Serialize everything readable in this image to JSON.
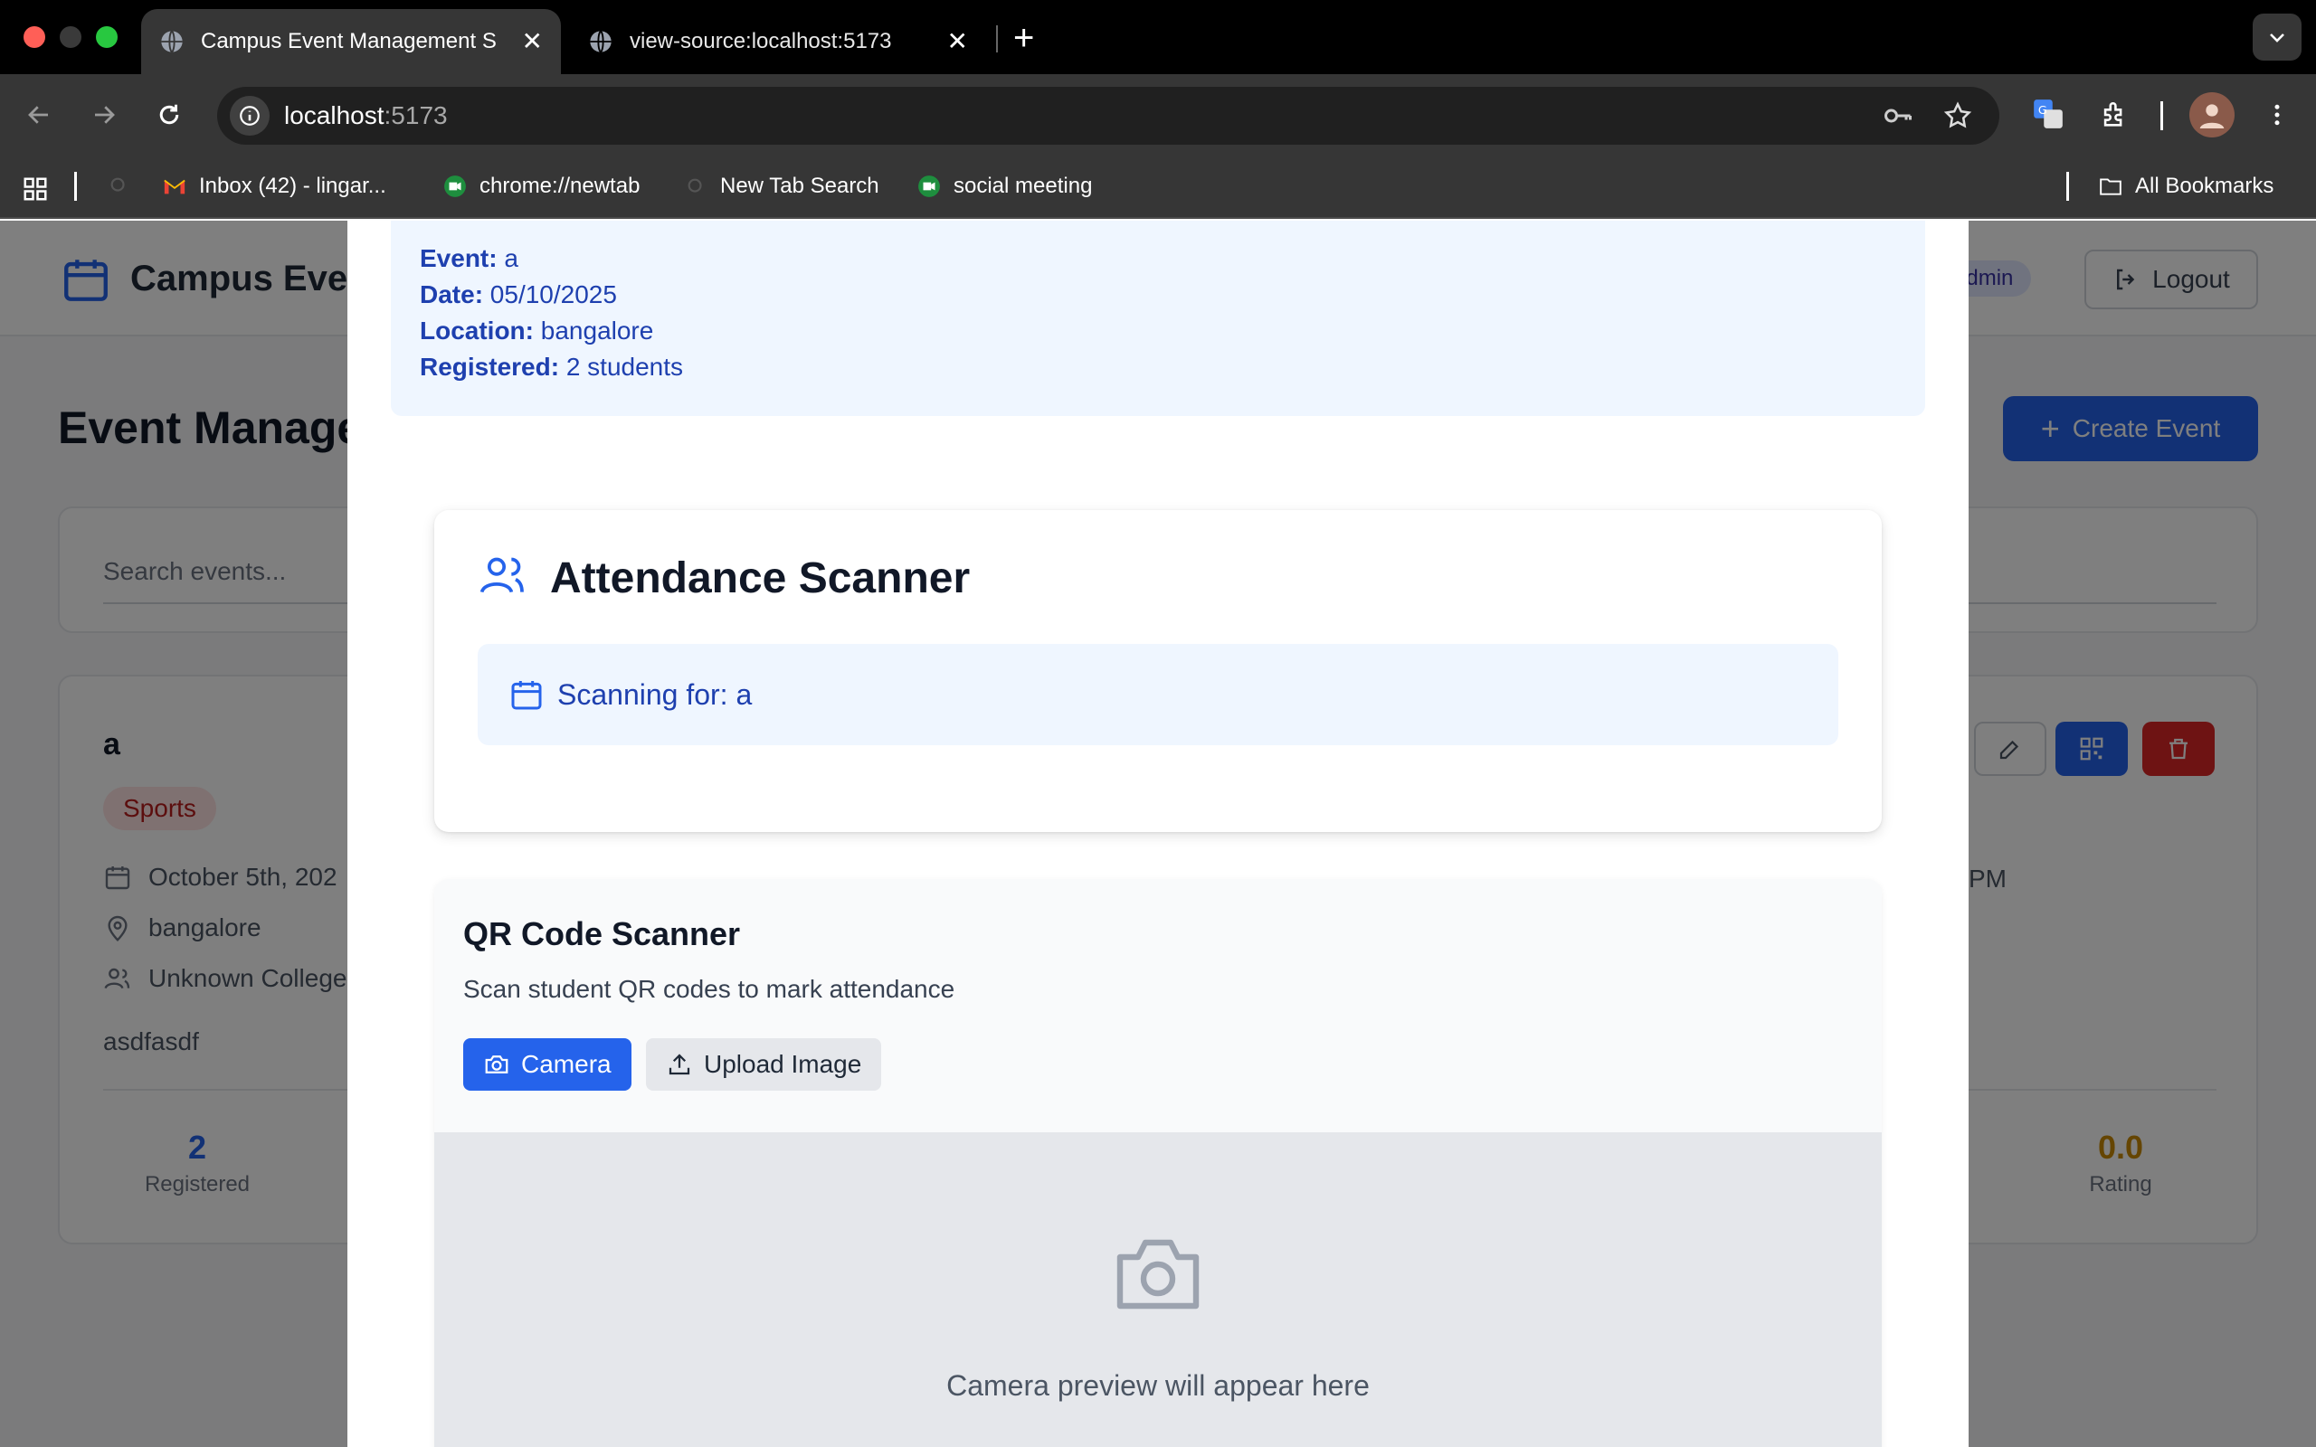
{
  "browser": {
    "tabs": [
      {
        "title": "Campus Event Management S",
        "active": true
      },
      {
        "title": "view-source:localhost:5173",
        "active": false
      }
    ],
    "url_host": "localhost",
    "url_port": ":5173",
    "bookmarks": [
      "Inbox (42) - lingar...",
      "chrome://newtab",
      "New Tab Search",
      "social meeting"
    ],
    "all_bookmarks": "All Bookmarks"
  },
  "app": {
    "title": "Campus Event",
    "role": "admin",
    "logout_label": "Logout",
    "page_title": "Event Manage",
    "create_label": "Create Event",
    "search_placeholder": "Search events...",
    "event": {
      "name": "a",
      "category": "Sports",
      "date": "October 5th, 202",
      "location": "bangalore",
      "college": "Unknown College",
      "description": "asdfasdf",
      "time_fragment": "PM",
      "registered_count": "2",
      "registered_label": "Registered",
      "rating_value": "0.0",
      "rating_label": "Rating"
    }
  },
  "modal": {
    "info": {
      "event_label": "Event:",
      "event_value": "a",
      "date_label": "Date:",
      "date_value": "05/10/2025",
      "location_label": "Location:",
      "location_value": "bangalore",
      "registered_label": "Registered:",
      "registered_value": "2 students"
    },
    "scanner_title": "Attendance Scanner",
    "scanning_for": "Scanning for: a",
    "qr_title": "QR Code Scanner",
    "qr_subtitle": "Scan student QR codes to mark attendance",
    "camera_label": "Camera",
    "upload_label": "Upload Image",
    "preview_text": "Camera preview will appear here"
  },
  "colors": {
    "primary": "#2563eb",
    "info_bg": "#eff6ff",
    "info_text": "#1e40af"
  }
}
